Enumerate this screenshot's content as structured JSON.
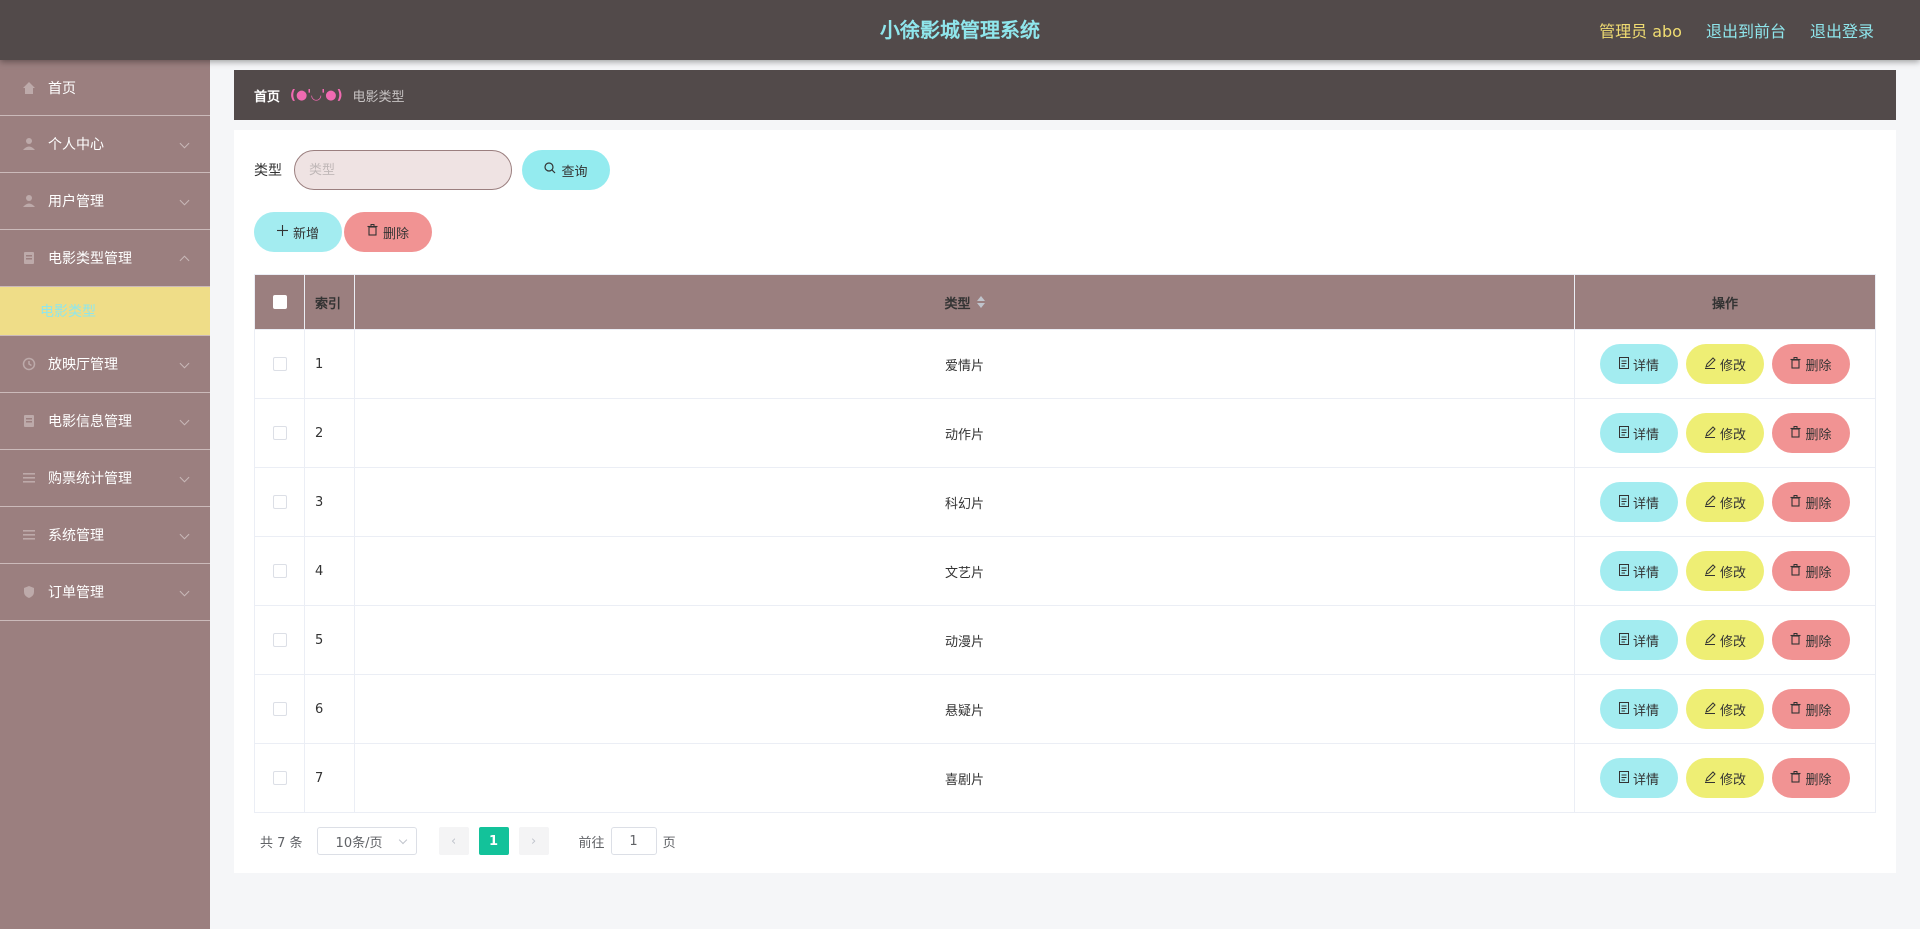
{
  "header": {
    "title": "小徐影城管理系统",
    "admin_label": "管理员 abo",
    "to_front": "退出到前台",
    "logout": "退出登录"
  },
  "sidebar": {
    "items": [
      {
        "label": "首页",
        "icon": "home-icon"
      },
      {
        "label": "个人中心",
        "icon": "user-icon"
      },
      {
        "label": "用户管理",
        "icon": "user-icon"
      },
      {
        "label": "电影类型管理",
        "icon": "box-icon",
        "expanded": true
      },
      {
        "label": "放映厅管理",
        "icon": "clock-icon"
      },
      {
        "label": "电影信息管理",
        "icon": "box-icon"
      },
      {
        "label": "购票统计管理",
        "icon": "list-icon"
      },
      {
        "label": "系统管理",
        "icon": "list-icon"
      },
      {
        "label": "订单管理",
        "icon": "shield-icon"
      }
    ],
    "sub_item": "电影类型"
  },
  "breadcrumb": {
    "home": "首页",
    "separator": "(●'◡'●)",
    "current": "电影类型"
  },
  "search": {
    "label": "类型",
    "placeholder": "类型",
    "query_button": "查询"
  },
  "actions": {
    "add": "新增",
    "delete": "删除"
  },
  "table": {
    "headers": {
      "index": "索引",
      "type": "类型",
      "ops": "操作"
    },
    "rows": [
      {
        "index": "1",
        "type": "爱情片"
      },
      {
        "index": "2",
        "type": "动作片"
      },
      {
        "index": "3",
        "type": "科幻片"
      },
      {
        "index": "4",
        "type": "文艺片"
      },
      {
        "index": "5",
        "type": "动漫片"
      },
      {
        "index": "6",
        "type": "悬疑片"
      },
      {
        "index": "7",
        "type": "喜剧片"
      }
    ],
    "row_buttons": {
      "detail": "详情",
      "edit": "修改",
      "delete": "删除"
    }
  },
  "pagination": {
    "total": "共 7 条",
    "page_size": "10条/页",
    "current_page": "1",
    "goto_prefix": "前往",
    "goto_value": "1",
    "goto_suffix": "页"
  },
  "colors": {
    "header_bg": "#524a4a",
    "sidebar_bg": "#9b7f7f",
    "accent_cyan": "#94ebef",
    "accent_yellow": "#eeee74",
    "accent_red": "#f19393",
    "active_page": "#13c29a"
  }
}
